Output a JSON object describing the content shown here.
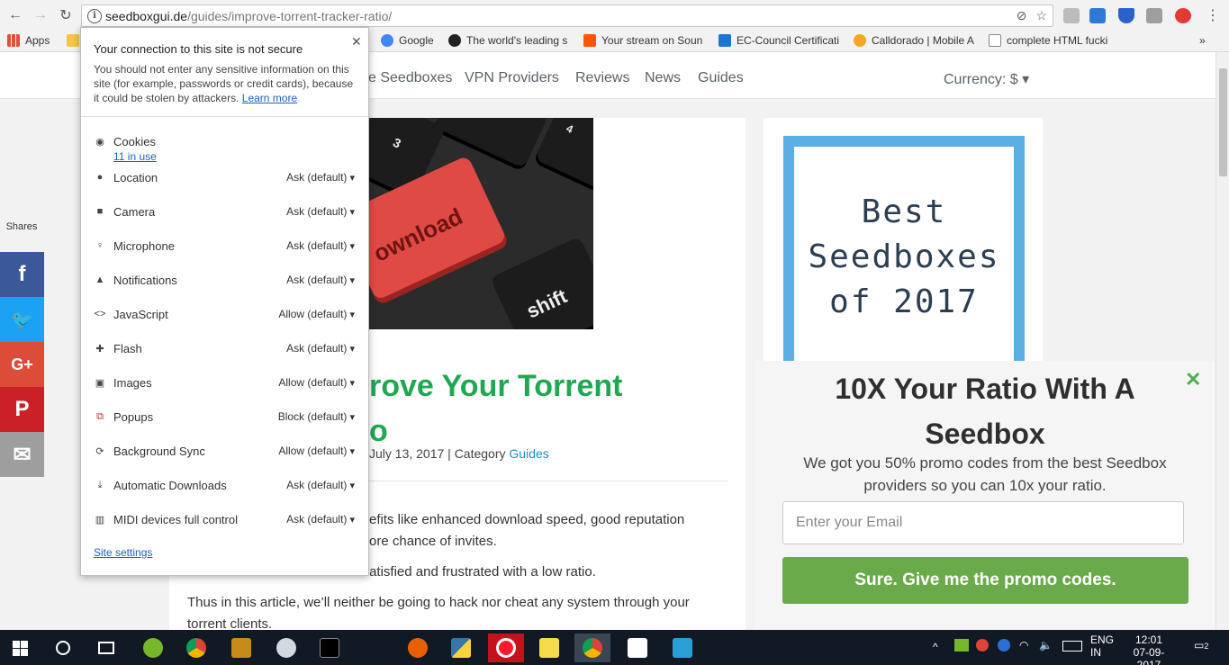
{
  "browser": {
    "url_host": "seedboxgui.de",
    "url_path": "/guides/improve-torrent-tracker-ratio/",
    "bookmarks": [
      {
        "label": "Apps",
        "color": "#e74c3c"
      },
      {
        "label": "Google",
        "color": "#4285f4"
      },
      {
        "label": "The world's leading s",
        "color": "#222222"
      },
      {
        "label": "Your stream on Soun",
        "color": "#ff5500"
      },
      {
        "label": "EC-Council Certificati",
        "color": "#1976d2"
      },
      {
        "label": "Calldorado | Mobile A",
        "color": "#f5a623"
      },
      {
        "label": "complete HTML fucki",
        "color": "#888888"
      }
    ],
    "more_bookmarks": "»"
  },
  "site": {
    "nav": [
      "e Seedboxes",
      "VPN Providers",
      "Reviews",
      "News",
      "Guides"
    ],
    "currency": "Currency: $ ▾"
  },
  "site_info": {
    "title": "Your connection to this site is not secure",
    "description": "You should not enter any sensitive information on this site (for example, passwords or credit cards), because it could be stolen by attackers.",
    "learn_more": "Learn more",
    "cookies_label": "Cookies",
    "cookies_count": "11 in use",
    "permissions": [
      {
        "icon": "location-icon",
        "label": "Location",
        "value": "Ask (default)"
      },
      {
        "icon": "camera-icon",
        "label": "Camera",
        "value": "Ask (default)"
      },
      {
        "icon": "microphone-icon",
        "label": "Microphone",
        "value": "Ask (default)"
      },
      {
        "icon": "notifications-icon",
        "label": "Notifications",
        "value": "Ask (default)"
      },
      {
        "icon": "javascript-icon",
        "label": "JavaScript",
        "value": "Allow (default)"
      },
      {
        "icon": "flash-icon",
        "label": "Flash",
        "value": "Ask (default)"
      },
      {
        "icon": "images-icon",
        "label": "Images",
        "value": "Allow (default)"
      },
      {
        "icon": "popups-icon",
        "label": "Popups",
        "value": "Block (default)"
      },
      {
        "icon": "background-sync-icon",
        "label": "Background Sync",
        "value": "Allow (default)"
      },
      {
        "icon": "download-icon",
        "label": "Automatic Downloads",
        "value": "Ask (default)"
      },
      {
        "icon": "midi-icon",
        "label": "MIDI devices full control",
        "value": "Ask (default)"
      }
    ],
    "site_settings": "Site settings"
  },
  "article": {
    "title_line1": "rove Your Torrent",
    "title_line2": "o",
    "meta_date": "July 13, 2017 | Category ",
    "meta_category": "Guides",
    "para1_line1": "efits like enhanced download speed, good reputation",
    "para1_line2": "ore chance of invites.",
    "para2": "Yet most of us tend to be not satisfied and frustrated with a low ratio.",
    "para3_line1": "Thus in this article, we’ll neither be going to hack nor cheat any system through your",
    "para3_line2": "torrent clients."
  },
  "hero": {
    "key_download": "ownload",
    "key_shift": "shift",
    "key_3": "3",
    "key_4": "4"
  },
  "ad": {
    "line1": "Best",
    "line2": "Seedboxes",
    "line3": "of 2017",
    "border_color": "#5aaee3"
  },
  "shares": {
    "label": "Shares",
    "buttons": [
      {
        "name": "facebook-share-button",
        "glyph": "f",
        "color": "#3b5998"
      },
      {
        "name": "twitter-share-button",
        "glyph": "🐦",
        "color": "#1da1f2"
      },
      {
        "name": "google-plus-share-button",
        "glyph": "G+",
        "color": "#dd4b39"
      },
      {
        "name": "pinterest-share-button",
        "glyph": "P",
        "color": "#cb2027"
      },
      {
        "name": "email-share-button",
        "glyph": "✉",
        "color": "#9e9e9e"
      }
    ]
  },
  "promo": {
    "title_line1": "10X Your Ratio With A",
    "title_line2": "Seedbox",
    "subtitle_line1": "We got you 50% promo codes from the best Seedbox",
    "subtitle_line2": "providers so you can 10x your ratio.",
    "email_placeholder": "Enter your Email",
    "button_label": "Sure. Give me the promo codes.",
    "close": "✕",
    "button_color": "#6aaa4a"
  },
  "taskbar": {
    "lang_line1": "ENG",
    "lang_line2": "IN",
    "time": "12:01",
    "date": "07-09-2017",
    "notifications": "2"
  }
}
